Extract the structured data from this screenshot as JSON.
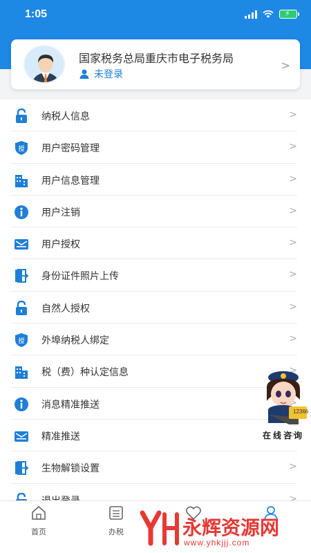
{
  "status": {
    "time": "1:05"
  },
  "profile": {
    "org_title": "国家税务总局重庆市电子税务局",
    "login_status": "未登录"
  },
  "menu_items": [
    {
      "label": "纳税人信息",
      "icon": "lock-icon"
    },
    {
      "label": "用户密码管理",
      "icon": "shield-auth-icon"
    },
    {
      "label": "用户信息管理",
      "icon": "building-icon"
    },
    {
      "label": "用户注销",
      "icon": "info-icon"
    },
    {
      "label": "用户授权",
      "icon": "mail-icon"
    },
    {
      "label": "身份证件照片上传",
      "icon": "door-exit-icon"
    },
    {
      "label": "自然人授权",
      "icon": "lock-icon"
    },
    {
      "label": "外埠纳税人绑定",
      "icon": "shield-auth-icon"
    },
    {
      "label": "税（费）种认定信息",
      "icon": "building-icon"
    },
    {
      "label": "消息精准推送",
      "icon": "info-icon"
    },
    {
      "label": "精准推送",
      "icon": "mail-icon"
    },
    {
      "label": "生物解锁设置",
      "icon": "door-exit-icon"
    },
    {
      "label": "退出登录",
      "icon": "lock-icon"
    }
  ],
  "icon_badge_text": "授",
  "chevron": ">",
  "mascot": {
    "label": "在线咨询",
    "badge": "12366"
  },
  "tabs": [
    {
      "label": "首页",
      "icon": "home-icon"
    },
    {
      "label": "办税",
      "icon": "list-icon"
    },
    {
      "label": "",
      "icon": "heart-icon"
    },
    {
      "label": "",
      "icon": "user-icon"
    }
  ],
  "watermark": {
    "text": "永辉资源网",
    "url": "www.yhkjjj.com"
  },
  "colors": {
    "primary": "#1e88e5",
    "accent_red": "#e53935",
    "text": "#333333"
  }
}
